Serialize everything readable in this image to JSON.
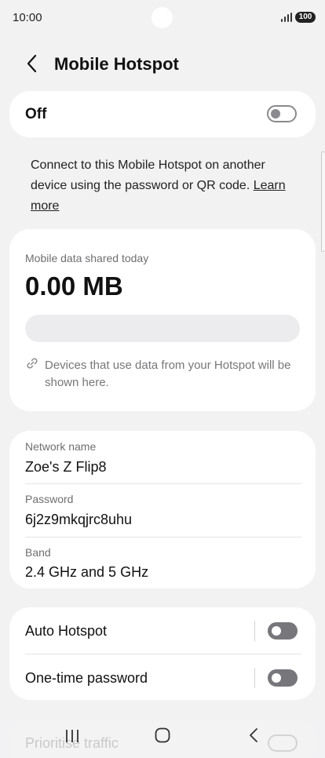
{
  "status_bar": {
    "time": "10:00",
    "battery": "100"
  },
  "header": {
    "title": "Mobile Hotspot"
  },
  "master_toggle": {
    "label": "Off",
    "state": "off"
  },
  "description": {
    "text": "Connect to this Mobile Hotspot on another device using the password or QR code.",
    "link": "Learn more"
  },
  "usage": {
    "label": "Mobile data shared today",
    "value": "0.00 MB",
    "shared_fraction": 0,
    "devices_note": "Devices that use data from your Hotspot will be shown here."
  },
  "network": {
    "name_label": "Network name",
    "name_value": "Zoe's Z Flip8",
    "password_label": "Password",
    "password_value": "6j2z9mkqjrc8uhu",
    "band_label": "Band",
    "band_value": "2.4 GHz and 5 GHz"
  },
  "options": {
    "auto_hotspot": {
      "label": "Auto Hotspot",
      "state": "off"
    },
    "one_time_password": {
      "label": "One-time password",
      "state": "off"
    },
    "prioritise_traffic": {
      "label": "Prioritise traffic",
      "state": "off"
    }
  },
  "nav": {
    "recents": "recents-icon",
    "home": "home-icon",
    "back": "back-icon"
  },
  "colors": {
    "background": "#f2f2f3",
    "card": "#ffffff",
    "toggle_off": "#8a8a8e",
    "muted_text": "#6f6f73"
  }
}
